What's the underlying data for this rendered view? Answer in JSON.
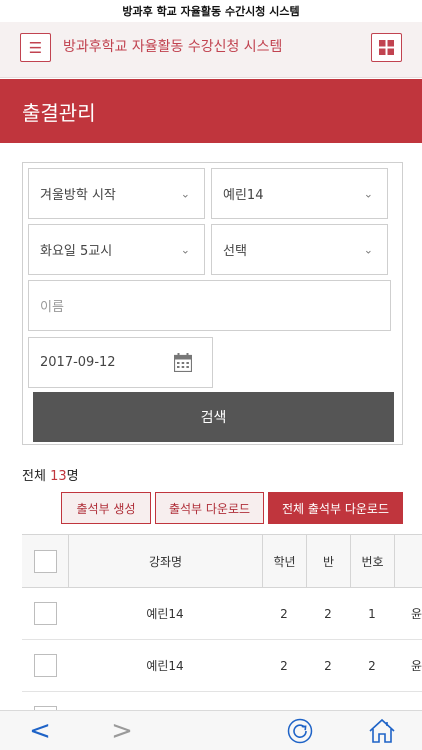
{
  "window": {
    "title": "방과후 학교 자율활동 수간시청 시스템"
  },
  "header": {
    "title": "방과후학교 자율활동 수강신청 시스템",
    "menu_icon": "menu-icon",
    "grid_icon": "grid-icon"
  },
  "page": {
    "title": "출결관리"
  },
  "filters": {
    "select1": "겨울방학 시작",
    "select2": "예린14",
    "select3": "화요일 5교시",
    "select4": "선택",
    "name_placeholder": "이름",
    "date": "2017-09-12",
    "search_label": "검색"
  },
  "summary": {
    "prefix": "전체 ",
    "count": "13",
    "suffix": "명"
  },
  "actions": {
    "create": "출석부 생성",
    "download": "출석부 다운로드",
    "download_all": "전체 출석부 다운로드"
  },
  "table": {
    "columns": [
      "강좌명",
      "학년",
      "반",
      "번호"
    ],
    "rows": [
      {
        "course": "예린14",
        "grade": "2",
        "class": "2",
        "number": "1",
        "extra": "윤"
      },
      {
        "course": "예린14",
        "grade": "2",
        "class": "2",
        "number": "2",
        "extra": "윤"
      }
    ]
  },
  "bottom_nav": {
    "back": "<",
    "forward": ">",
    "refresh_icon": "refresh-icon",
    "home_icon": "home-icon"
  },
  "colors": {
    "accent": "#c0353d",
    "search_button": "#555555"
  }
}
